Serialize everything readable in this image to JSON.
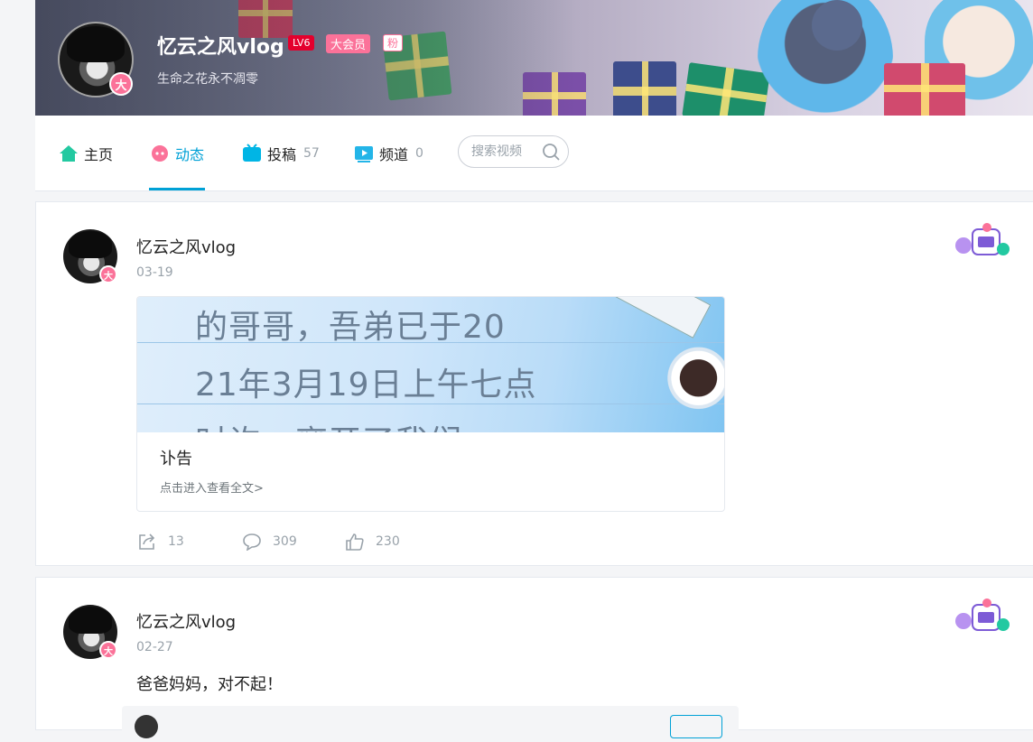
{
  "profile": {
    "name": "忆云之风vlog",
    "level": "LV6",
    "vip": "大会员",
    "fan_badge": "粉",
    "avatar_badge": "大",
    "sign": "生命之花永不凋零"
  },
  "nav": {
    "home": {
      "label": "主页"
    },
    "dynamic": {
      "label": "动态"
    },
    "post": {
      "label": "投稿",
      "count": "57"
    },
    "channel": {
      "label": "频道",
      "count": "0"
    },
    "search_placeholder": "搜索视频"
  },
  "colors": {
    "accent": "#00a1d6",
    "pink": "#fb7299",
    "level_red": "#e4002d",
    "home_green": "#23c9a1"
  },
  "posts": [
    {
      "author": "忆云之风vlog",
      "date": "03-19",
      "article": {
        "cover_lines": [
          "的哥哥，吾弟已于20",
          "21年3月19日上午七点",
          "时许，离开了我们"
        ],
        "title": "讣告",
        "more": "点击进入查看全文>"
      },
      "share_count": "13",
      "comment_count": "309",
      "like_count": "230"
    },
    {
      "author": "忆云之风vlog",
      "date": "02-27",
      "text": "爸爸妈妈，对不起！"
    }
  ]
}
